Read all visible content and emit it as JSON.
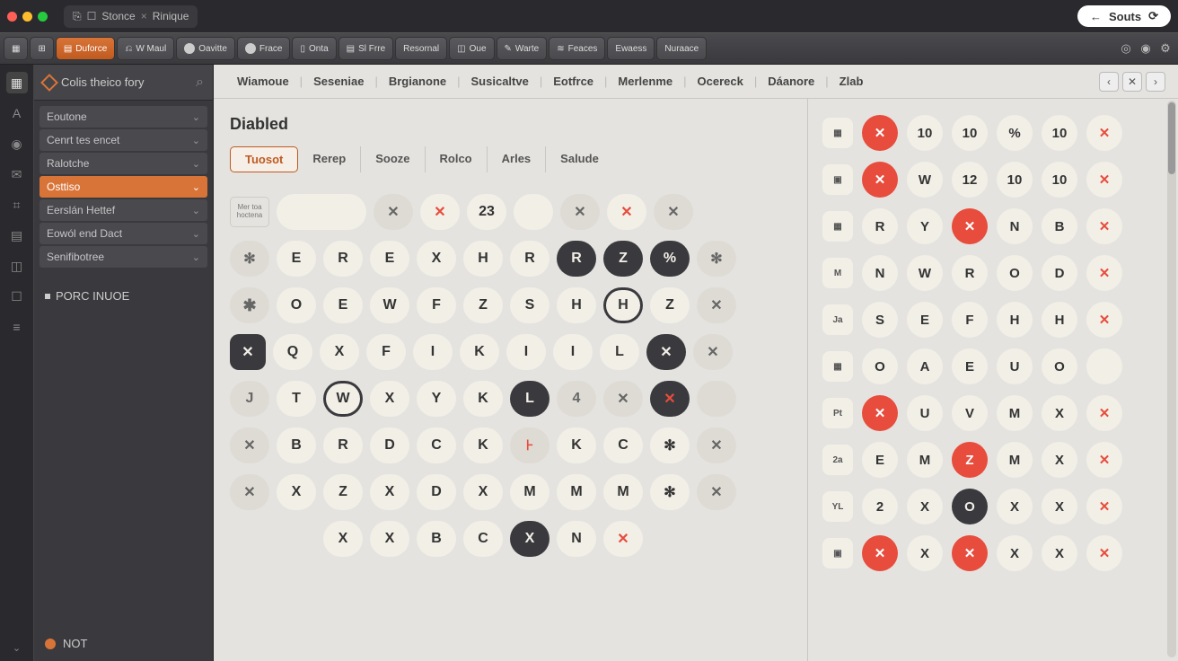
{
  "window": {
    "tabs": [
      {
        "icons": [
          "⎘",
          "☐"
        ],
        "label": "Stonce",
        "close": "×"
      },
      {
        "label": "Rinique"
      }
    ],
    "souts": {
      "back": "←",
      "label": "Souts",
      "refresh": "⟳"
    }
  },
  "toolbar": {
    "items": [
      {
        "icon": "▦",
        "label": ""
      },
      {
        "icon": "⊞",
        "label": ""
      },
      {
        "icon": "▤",
        "label": "Duforce",
        "accent": true
      },
      {
        "icon": "⎌",
        "label": "W Maul"
      },
      {
        "dot": true,
        "label": "Oavitte"
      },
      {
        "dot": true,
        "label": "Frace"
      },
      {
        "icon": "▯",
        "label": "Onta"
      },
      {
        "icon": "▤",
        "label": "Sl Frre"
      },
      {
        "icon": "",
        "label": "Resornal"
      },
      {
        "icon": "◫",
        "label": "Oue"
      },
      {
        "icon": "✎",
        "label": "Warte"
      },
      {
        "icon": "≋",
        "label": "Feaces"
      },
      {
        "icon": "",
        "label": "Ewaess"
      },
      {
        "icon": "",
        "label": "Nuraace"
      }
    ],
    "rightIcons": [
      "◎",
      "◉",
      "⚙"
    ]
  },
  "iconrail": [
    "▦",
    "A",
    "◉",
    "✉",
    "⌗",
    "▤",
    "◫",
    "☐",
    "≡"
  ],
  "sidebar": {
    "title": "Colis theico  fory",
    "searchIcon": "⌕",
    "items": [
      {
        "label": "Eoutone"
      },
      {
        "label": "Cenrt tes encet"
      },
      {
        "label": "Ralotche"
      },
      {
        "label": "Osttiso",
        "selected": true
      },
      {
        "label": "Eerslán Hettef"
      },
      {
        "label": "Eowól end Dact"
      },
      {
        "label": "Senifibotree"
      }
    ],
    "action": "PORC INUOE",
    "footer": "NOT"
  },
  "menubar": {
    "items": [
      "Wiamoue",
      "Seseniae",
      "Brgianone",
      "Susicaltve",
      "Eotfrce",
      "Merlenme",
      "Ocereck",
      "Dáanore",
      "Zlab"
    ],
    "nav": [
      "‹",
      "✕",
      "›"
    ]
  },
  "leftPanel": {
    "title": "Diabled",
    "tabs": [
      "Tuosot",
      "Rerep",
      "Sooze",
      "Rolco",
      "Arles",
      "Salude"
    ],
    "activeTab": 0,
    "topRowLabel": "Mer toa hoctena",
    "topRow": [
      {
        "t": "",
        "c": "wide"
      },
      {
        "t": "✕",
        "c": "dim"
      },
      {
        "t": "✕",
        "c": "redx"
      },
      {
        "t": "23",
        "c": ""
      },
      {
        "t": "",
        "c": ""
      },
      {
        "t": "✕",
        "c": "dim"
      },
      {
        "t": "✕",
        "c": "redx"
      },
      {
        "t": "✕",
        "c": "dim"
      }
    ],
    "grid": [
      [
        {
          "t": "✻",
          "c": "dim"
        },
        {
          "t": "E"
        },
        {
          "t": "R"
        },
        {
          "t": "E"
        },
        {
          "t": "X"
        },
        {
          "t": "H"
        },
        {
          "t": "R"
        },
        {
          "t": "R",
          "c": "dark"
        },
        {
          "t": "Z",
          "c": "dark"
        },
        {
          "t": "%",
          "c": "dark"
        },
        {
          "t": "✻",
          "c": "dim"
        }
      ],
      [
        {
          "t": "✱",
          "c": "dim sym"
        },
        {
          "t": "O"
        },
        {
          "t": "E"
        },
        {
          "t": "W"
        },
        {
          "t": "F"
        },
        {
          "t": "Z"
        },
        {
          "t": "S"
        },
        {
          "t": "H"
        },
        {
          "t": "H",
          "c": "ring"
        },
        {
          "t": "Z"
        },
        {
          "t": "✕",
          "c": "dim"
        }
      ],
      [
        {
          "t": "✕",
          "c": "dark sq"
        },
        {
          "t": "Q"
        },
        {
          "t": "X"
        },
        {
          "t": "F"
        },
        {
          "t": "I"
        },
        {
          "t": "K"
        },
        {
          "t": "I"
        },
        {
          "t": "I"
        },
        {
          "t": "L"
        },
        {
          "t": "✕",
          "c": "dark"
        },
        {
          "t": "✕",
          "c": "dim"
        }
      ],
      [
        {
          "t": "J",
          "c": "dim"
        },
        {
          "t": "T"
        },
        {
          "t": "W",
          "c": "ring"
        },
        {
          "t": "X"
        },
        {
          "t": "Y"
        },
        {
          "t": "K"
        },
        {
          "t": "L",
          "c": "dark"
        },
        {
          "t": "4",
          "c": "dim"
        },
        {
          "t": "✕",
          "c": "dim"
        },
        {
          "t": "✕",
          "c": "dark special"
        },
        {
          "t": "",
          "c": "dim"
        }
      ],
      [
        {
          "t": "✕",
          "c": "dim"
        },
        {
          "t": "B"
        },
        {
          "t": "R"
        },
        {
          "t": "D"
        },
        {
          "t": "C"
        },
        {
          "t": "K"
        },
        {
          "t": "⊦",
          "c": "dim special"
        },
        {
          "t": "K"
        },
        {
          "t": "C"
        },
        {
          "t": "✻"
        },
        {
          "t": "✕",
          "c": "dim"
        }
      ],
      [
        {
          "t": "✕",
          "c": "dim"
        },
        {
          "t": "X"
        },
        {
          "t": "Z"
        },
        {
          "t": "X"
        },
        {
          "t": "D"
        },
        {
          "t": "X"
        },
        {
          "t": "M"
        },
        {
          "t": "M"
        },
        {
          "t": "M"
        },
        {
          "t": "✻"
        },
        {
          "t": "✕",
          "c": "dim"
        }
      ],
      [
        {
          "t": "",
          "c": "none"
        },
        {
          "t": "",
          "c": "none"
        },
        {
          "t": "X"
        },
        {
          "t": "X"
        },
        {
          "t": "B"
        },
        {
          "t": "C"
        },
        {
          "t": "X",
          "c": "dark"
        },
        {
          "t": "N"
        },
        {
          "t": "✕",
          "c": "ringred"
        },
        {
          "t": "",
          "c": "none"
        },
        {
          "t": "",
          "c": "none"
        }
      ]
    ]
  },
  "rightPanel": {
    "rows": [
      {
        "hdr": "▦",
        "cells": [
          {
            "t": "✕",
            "c": "red"
          },
          {
            "t": "10"
          },
          {
            "t": "10"
          },
          {
            "t": "%"
          },
          {
            "t": "10"
          },
          {
            "t": "✕",
            "c": "redx"
          }
        ]
      },
      {
        "hdr": "▣",
        "cells": [
          {
            "t": "✕",
            "c": "red"
          },
          {
            "t": "W"
          },
          {
            "t": "12"
          },
          {
            "t": "10"
          },
          {
            "t": "10"
          },
          {
            "t": "✕",
            "c": "redx"
          }
        ]
      },
      {
        "hdr": "▦",
        "cells": [
          {
            "t": "R"
          },
          {
            "t": "Y"
          },
          {
            "t": "✕",
            "c": "red"
          },
          {
            "t": "N"
          },
          {
            "t": "B"
          },
          {
            "t": "✕",
            "c": "redx"
          }
        ]
      },
      {
        "hdr": "M",
        "cells": [
          {
            "t": "N"
          },
          {
            "t": "W"
          },
          {
            "t": "R"
          },
          {
            "t": "O"
          },
          {
            "t": "D"
          },
          {
            "t": "✕",
            "c": "redx"
          }
        ]
      },
      {
        "hdr": "Ja",
        "cells": [
          {
            "t": "S"
          },
          {
            "t": "E"
          },
          {
            "t": "F"
          },
          {
            "t": "H"
          },
          {
            "t": "H"
          },
          {
            "t": "✕",
            "c": "redx"
          }
        ]
      },
      {
        "hdr": "▦",
        "cells": [
          {
            "t": "O"
          },
          {
            "t": "A"
          },
          {
            "t": "E"
          },
          {
            "t": "U"
          },
          {
            "t": "O"
          },
          {
            "t": "",
            "c": ""
          }
        ]
      },
      {
        "hdr": "Pt",
        "cells": [
          {
            "t": "✕",
            "c": "red"
          },
          {
            "t": "U"
          },
          {
            "t": "V"
          },
          {
            "t": "M"
          },
          {
            "t": "X"
          },
          {
            "t": "✕",
            "c": "redx"
          }
        ]
      },
      {
        "hdr": "2a",
        "cells": [
          {
            "t": "E"
          },
          {
            "t": "M"
          },
          {
            "t": "Z",
            "c": "red"
          },
          {
            "t": "M"
          },
          {
            "t": "X"
          },
          {
            "t": "✕",
            "c": "redx"
          }
        ]
      },
      {
        "hdr": "YL",
        "cells": [
          {
            "t": "2"
          },
          {
            "t": "X"
          },
          {
            "t": "O",
            "c": "dark"
          },
          {
            "t": "X"
          },
          {
            "t": "X"
          },
          {
            "t": "✕",
            "c": "redx"
          }
        ]
      },
      {
        "hdr": "▣",
        "cells": [
          {
            "t": "✕",
            "c": "red"
          },
          {
            "t": "X"
          },
          {
            "t": "✕",
            "c": "red"
          },
          {
            "t": "X"
          },
          {
            "t": "X"
          },
          {
            "t": "✕",
            "c": "redx"
          }
        ]
      }
    ]
  }
}
